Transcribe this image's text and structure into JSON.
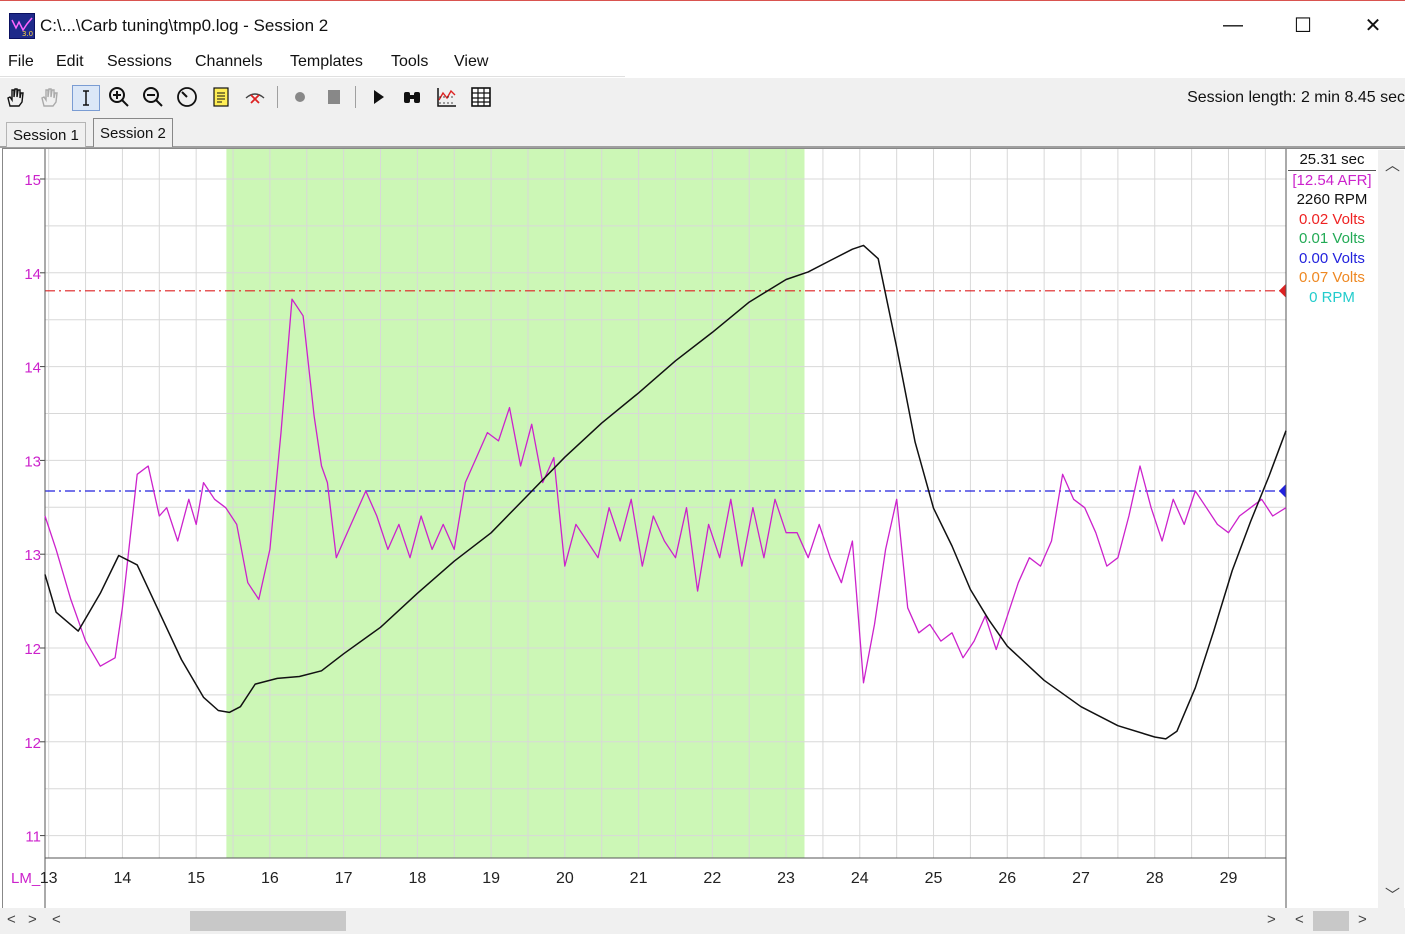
{
  "window": {
    "title": "C:\\...\\Carb tuning\\tmp0.log - Session 2",
    "minimize_glyph": "—",
    "maximize_glyph": "☐",
    "close_glyph": "✕"
  },
  "menu": [
    "File",
    "Edit",
    "Sessions",
    "Channels",
    "Templates",
    "Tools",
    "View"
  ],
  "toolbar": {
    "icons": [
      "hand-pan-icon",
      "hand-disabled-icon",
      "text-cursor-icon",
      "zoom-in-icon",
      "zoom-out-icon",
      "gauge-icon",
      "notes-icon",
      "cursor-off-icon",
      "record-icon",
      "stop-icon",
      "play-icon",
      "binoculars-icon",
      "graph-channels-icon",
      "table-icon"
    ],
    "session_length": "Session length:  2 min 8.45 sec"
  },
  "tabs": [
    {
      "label": "Session 1",
      "active": false
    },
    {
      "label": "Session 2",
      "active": true
    }
  ],
  "readout": [
    {
      "text": "25.31 sec",
      "color": "#111111"
    },
    {
      "text": "[12.54 AFR]",
      "color": "#cc22cc"
    },
    {
      "text": "2260 RPM",
      "color": "#111111"
    },
    {
      "text": "0.02 Volts",
      "color": "#ee2222"
    },
    {
      "text": "0.01 Volts",
      "color": "#22aa55"
    },
    {
      "text": "0.00 Volts",
      "color": "#2222dd"
    },
    {
      "text": "0.07 Volts",
      "color": "#ee8822"
    },
    {
      "text": "0 RPM",
      "color": "#22cccc"
    }
  ],
  "chart_data": {
    "type": "line",
    "x_axis": {
      "label": "LM_",
      "ticks": [
        13,
        14,
        15,
        16,
        17,
        18,
        19,
        20,
        21,
        22,
        23,
        24,
        25,
        26,
        27,
        28,
        29
      ],
      "range": [
        12.95,
        29.78
      ]
    },
    "y_axis": {
      "tick_labels": [
        "15",
        "14",
        "14",
        "13",
        "13",
        "12",
        "12",
        "11"
      ],
      "color": "#cc22cc"
    },
    "highlight_range": [
      15.41,
      23.25
    ],
    "reference_lines": [
      {
        "name": "red",
        "color": "#dd2222",
        "axis_value_afr": 14.35
      },
      {
        "name": "blue",
        "color": "#2222dd",
        "axis_value_afr": 13.15
      }
    ],
    "series": [
      {
        "color": "#cc22cc",
        "x": [
          12.95,
          13.1,
          13.3,
          13.5,
          13.7,
          13.9,
          14.0,
          14.2,
          14.35,
          14.5,
          14.6,
          14.75,
          14.9,
          15.0,
          15.1,
          15.25,
          15.4,
          15.55,
          15.7,
          15.85,
          16.0,
          16.15,
          16.3,
          16.45,
          16.6,
          16.7,
          16.78,
          16.9,
          17.0,
          17.15,
          17.3,
          17.45,
          17.6,
          17.75,
          17.9,
          18.05,
          18.2,
          18.35,
          18.5,
          18.65,
          18.8,
          18.95,
          19.1,
          19.25,
          19.4,
          19.55,
          19.7,
          19.85,
          20.0,
          20.15,
          20.3,
          20.45,
          20.6,
          20.75,
          20.9,
          21.05,
          21.2,
          21.35,
          21.5,
          21.65,
          21.8,
          21.95,
          22.1,
          22.25,
          22.4,
          22.55,
          22.7,
          22.85,
          23.0,
          23.15,
          23.3,
          23.45,
          23.6,
          23.75,
          23.9,
          24.05,
          24.2,
          24.35,
          24.5,
          24.65,
          24.8,
          24.95,
          25.1,
          25.25,
          25.4,
          25.55,
          25.7,
          25.85,
          26.0,
          26.15,
          26.3,
          26.45,
          26.6,
          26.75,
          26.9,
          27.05,
          27.2,
          27.35,
          27.5,
          27.65,
          27.8,
          27.95,
          28.1,
          28.25,
          28.4,
          28.55,
          28.7,
          28.85,
          29.0,
          29.15,
          29.3,
          29.45,
          29.6,
          29.78
        ],
        "y": [
          13.0,
          12.8,
          12.5,
          12.25,
          12.1,
          12.15,
          12.45,
          13.25,
          13.3,
          13.0,
          13.05,
          12.85,
          13.1,
          12.95,
          13.2,
          13.1,
          13.05,
          12.95,
          12.6,
          12.5,
          12.8,
          13.5,
          14.3,
          14.2,
          13.6,
          13.3,
          13.2,
          12.75,
          12.85,
          13.0,
          13.15,
          13.0,
          12.8,
          12.95,
          12.75,
          13.0,
          12.8,
          12.95,
          12.8,
          13.2,
          13.35,
          13.5,
          13.45,
          13.65,
          13.3,
          13.55,
          13.2,
          13.35,
          12.7,
          12.95,
          12.85,
          12.75,
          13.05,
          12.85,
          13.1,
          12.7,
          13.0,
          12.85,
          12.75,
          13.05,
          12.55,
          12.95,
          12.75,
          13.1,
          12.7,
          13.05,
          12.75,
          13.1,
          12.9,
          12.9,
          12.75,
          12.95,
          12.75,
          12.6,
          12.85,
          12.0,
          12.35,
          12.8,
          13.1,
          12.45,
          12.3,
          12.35,
          12.25,
          12.3,
          12.15,
          12.25,
          12.4,
          12.2,
          12.4,
          12.6,
          12.75,
          12.7,
          12.85,
          13.25,
          13.1,
          13.05,
          12.9,
          12.7,
          12.75,
          13.0,
          13.3,
          13.05,
          12.85,
          13.1,
          12.95,
          13.15,
          13.05,
          12.95,
          12.9,
          13.0,
          13.05,
          13.1,
          13.0,
          13.05
        ],
        "y_screen_note": "values in AFR"
      },
      {
        "color": "#111111",
        "x": [
          12.95,
          13.1,
          13.4,
          13.7,
          13.95,
          14.2,
          14.5,
          14.8,
          15.1,
          15.3,
          15.45,
          15.6,
          15.8,
          16.1,
          16.4,
          16.7,
          17.0,
          17.5,
          18.0,
          18.5,
          19.0,
          19.5,
          20.0,
          20.5,
          21.0,
          21.5,
          22.0,
          22.5,
          23.0,
          23.3,
          23.6,
          23.9,
          24.05,
          24.25,
          24.5,
          24.75,
          25.0,
          25.25,
          25.5,
          25.75,
          26.0,
          26.5,
          27.0,
          27.5,
          28.0,
          28.15,
          28.3,
          28.55,
          28.8,
          29.05,
          29.3,
          29.55,
          29.78
        ],
        "y": [
          1800,
          1600,
          1500,
          1700,
          1900,
          1850,
          1600,
          1350,
          1150,
          1080,
          1070,
          1100,
          1220,
          1250,
          1260,
          1290,
          1380,
          1520,
          1700,
          1870,
          2020,
          2220,
          2420,
          2600,
          2760,
          2930,
          3080,
          3240,
          3360,
          3400,
          3460,
          3520,
          3540,
          3470,
          3000,
          2500,
          2150,
          1950,
          1720,
          1560,
          1420,
          1240,
          1100,
          1000,
          940,
          930,
          970,
          1200,
          1500,
          1820,
          2080,
          2320,
          2560
        ],
        "unit": "RPM"
      }
    ]
  }
}
